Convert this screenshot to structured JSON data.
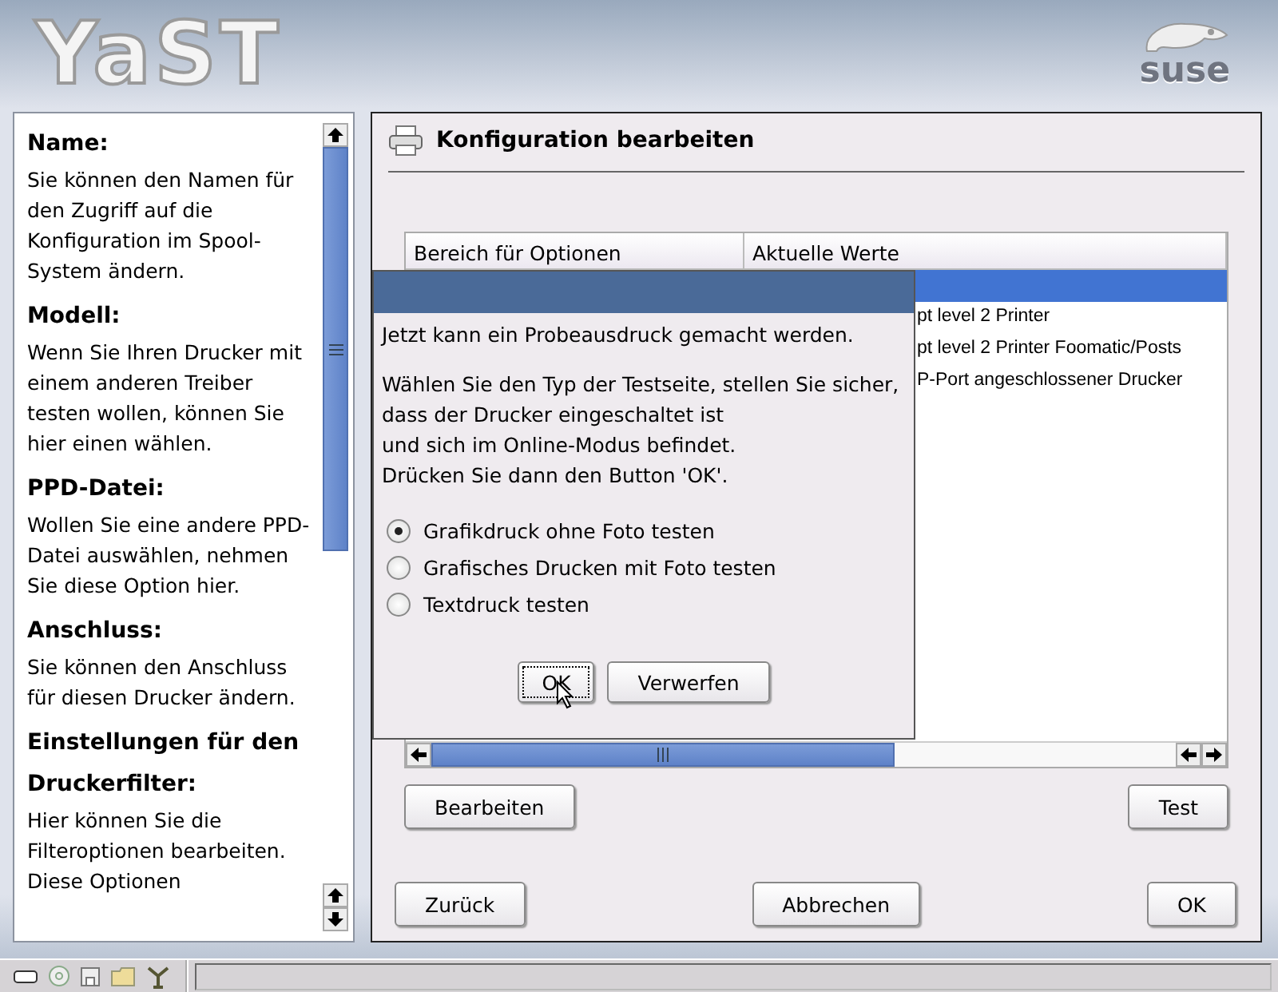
{
  "header": {
    "logo": "YaST",
    "brand": "suse"
  },
  "help": {
    "sections": [
      {
        "heading": "Name:",
        "text": "Sie können den Namen für den Zugriff auf die Konfiguration im Spool-System ändern."
      },
      {
        "heading": "Modell:",
        "text": "Wenn Sie Ihren Drucker mit einem anderen Treiber testen wollen, können Sie hier einen wählen."
      },
      {
        "heading": "PPD-Datei:",
        "text": "Wollen Sie eine andere PPD-Datei auswählen, nehmen Sie diese Option hier."
      },
      {
        "heading": "Anschluss:",
        "text": "Sie können den Anschluss für diesen Drucker ändern."
      },
      {
        "heading": "Einstellungen für den Druckerfilter:",
        "text": "Hier können Sie die Filteroptionen bearbeiten. Diese Optionen"
      }
    ]
  },
  "page": {
    "title": "Konfiguration bearbeiten",
    "table": {
      "columns": [
        "Bereich für Optionen",
        "Aktuelle Werte"
      ],
      "rows": [
        {
          "selected": true
        },
        {
          "column_2": "pt level 2 Printer",
          "selected": false
        },
        {
          "column_2": "pt level 2 Printer Foomatic/Posts",
          "selected": false
        },
        {
          "column_2": "P-Port angeschlossener Drucker",
          "selected": false
        }
      ]
    },
    "actions": [
      "Bearbeiten",
      "Test"
    ],
    "navigation": [
      "Zurück",
      "Abbrechen",
      "OK"
    ]
  },
  "dialog": {
    "message": [
      "Jetzt kann ein Probeausdruck gemacht werden.",
      "Wählen Sie den Typ der Testseite, stellen Sie sicher,\ndass der Drucker eingeschaltet ist\nund sich im Online-Modus befindet.\nDrücken Sie dann den Button 'OK'."
    ],
    "options": [
      {
        "label": "Grafikdruck ohne Foto testen",
        "selected": true
      },
      {
        "label": "Grafisches Drucken mit Foto testen",
        "selected": false
      },
      {
        "label": "Textdruck testen",
        "selected": false
      }
    ],
    "buttons": [
      {
        "label": "OK",
        "focused": true
      },
      {
        "label": "Verwerfen",
        "focused": false
      }
    ]
  }
}
